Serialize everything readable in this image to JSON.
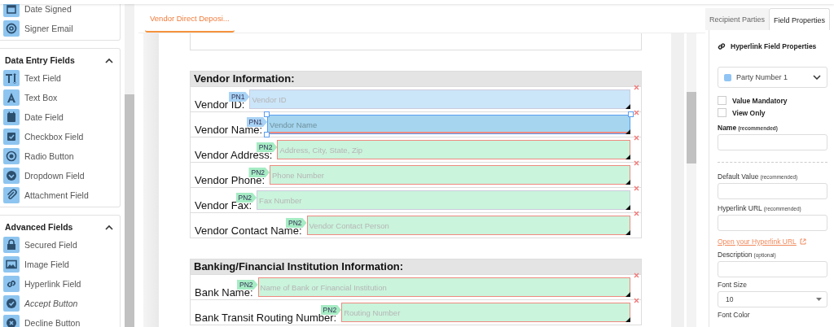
{
  "sidebar": {
    "sections": [
      {
        "items": [
          {
            "label": "Date Signed",
            "kind": "date",
            "italic": false
          },
          {
            "label": "Signer Email",
            "kind": "email",
            "italic": false
          }
        ]
      },
      {
        "title": "Data Entry Fields",
        "expanded": true,
        "items": [
          {
            "label": "Text Field",
            "kind": "textfield",
            "italic": false
          },
          {
            "label": "Text Box",
            "kind": "textbox",
            "italic": false
          },
          {
            "label": "Date Field",
            "kind": "calendar",
            "italic": false
          },
          {
            "label": "Checkbox Field",
            "kind": "checkbox",
            "italic": false
          },
          {
            "label": "Radio Button",
            "kind": "radio",
            "italic": false
          },
          {
            "label": "Dropdown Field",
            "kind": "dropdown",
            "italic": false
          },
          {
            "label": "Attachment Field",
            "kind": "attachment",
            "italic": false
          }
        ]
      },
      {
        "title": "Advanced Fields",
        "expanded": true,
        "items": [
          {
            "label": "Secured Field",
            "kind": "lock",
            "italic": false
          },
          {
            "label": "Image Field",
            "kind": "image",
            "italic": false
          },
          {
            "label": "Hyperlink Field",
            "kind": "link",
            "italic": false
          },
          {
            "label": "Accept Button",
            "kind": "accept",
            "italic": true
          },
          {
            "label": "Decline Button",
            "kind": "decline",
            "italic": false
          }
        ]
      }
    ]
  },
  "document_tabs": [
    {
      "label": "Vendor Direct Deposi...",
      "selected": true
    }
  ],
  "document": {
    "sections": [
      {
        "title": "Vendor Information:",
        "rows": [
          {
            "label": "Vendor ID:",
            "party": "PN1",
            "placeholder": "Vendor ID",
            "color": "#a9d3f5",
            "required": false,
            "selected": false
          },
          {
            "label": "Vendor Name:",
            "party": "PN1",
            "placeholder": "Vendor Name",
            "color": "#a9d3f5",
            "required": true,
            "selected": true
          },
          {
            "label": "Vendor Address:",
            "party": "PN2",
            "placeholder": "Address, City, State, Zip",
            "color": "#a6ecc4",
            "required": true,
            "selected": false
          },
          {
            "label": "Vendor Phone:",
            "party": "PN2",
            "placeholder": "Phone Number",
            "color": "#a6ecc4",
            "required": true,
            "selected": false
          },
          {
            "label": "Vendor Fax:",
            "party": "PN2",
            "placeholder": "Fax Number",
            "color": "#a6ecc4",
            "required": false,
            "selected": false
          },
          {
            "label": "Vendor Contact Name:",
            "party": "PN2",
            "placeholder": "Vendor Contact Person",
            "color": "#a6ecc4",
            "required": true,
            "selected": false
          }
        ]
      },
      {
        "title": "Banking/Financial Institution Information:",
        "rows": [
          {
            "label": "Bank Name:",
            "party": "PN2",
            "placeholder": "Name of Bank or Financial Institution",
            "color": "#a6ecc4",
            "required": true,
            "selected": false
          },
          {
            "label": "Bank Transit Routing Number:",
            "party": "PN2",
            "placeholder": "Routing Number",
            "color": "#a6ecc4",
            "required": true,
            "selected": false
          }
        ]
      }
    ]
  },
  "properties_panel": {
    "tabs": [
      {
        "label": "Recipient Parties",
        "selected": false
      },
      {
        "label": "Field Properties",
        "selected": true
      }
    ],
    "title": "Hyperlink Field Properties",
    "party_select": {
      "value": "Party Number 1",
      "color": "#90c4f4"
    },
    "checkboxes": [
      {
        "label": "Value Mandatory",
        "checked": false
      },
      {
        "label": "View Only",
        "checked": false
      }
    ],
    "items": [
      {
        "kind": "input",
        "label": "Name",
        "note": "(recommended)",
        "strong": true
      },
      {
        "kind": "divider"
      },
      {
        "kind": "input",
        "label": "Default Value",
        "note": "(recommended)",
        "strong": false
      },
      {
        "kind": "input",
        "label": "Hyperlink URL",
        "note": "(recommended)",
        "strong": false
      },
      {
        "kind": "link",
        "label": "Open your Hyperlink URL"
      },
      {
        "kind": "input",
        "label": "Description",
        "note": "(optional)",
        "strong": false
      },
      {
        "kind": "select",
        "label": "Font Size",
        "value": "10"
      },
      {
        "kind": "heading",
        "label": "Font Color"
      }
    ]
  }
}
